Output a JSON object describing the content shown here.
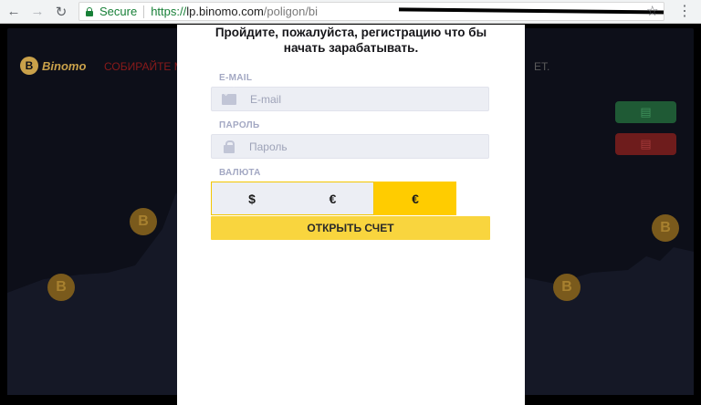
{
  "browser": {
    "secure_label": "Secure",
    "url_scheme": "https://",
    "url_host": "lp.binomo.com",
    "url_path": "/poligon/bi"
  },
  "background": {
    "logo_text": "Binomo",
    "promo_text": "СОБИРАЙТЕ М",
    "promo_end": "ЕТ."
  },
  "modal": {
    "title_line1": "Пройдите, пожалуйста, регистрацию что бы",
    "title_line2": "начать зарабатывать.",
    "email_label": "E-MAIL",
    "email_placeholder": "E-mail",
    "password_label": "ПАРОЛЬ",
    "password_placeholder": "Пароль",
    "currency_label": "ВАЛЮТА",
    "currencies": [
      "$",
      "€",
      "€"
    ],
    "selected_currency_index": 2,
    "submit_label": "ОТКРЫТЬ СЧЕТ"
  },
  "colors": {
    "accent_yellow": "#ffcc00",
    "button_yellow": "#f9d53e",
    "label_gray": "#a3a8c3",
    "secure_green": "#188038"
  }
}
